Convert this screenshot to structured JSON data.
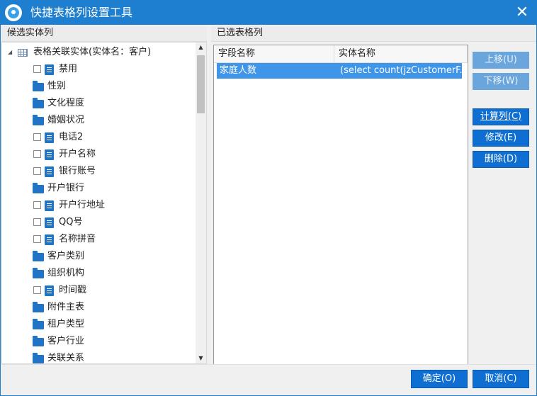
{
  "window": {
    "title": "快捷表格列设置工具",
    "close_icon": "close-icon",
    "accent_color": "#1e7fd0",
    "selection_color": "#3f95e8"
  },
  "left_panel": {
    "header": "候选实体列",
    "tree": {
      "root_label": "表格关联实体(实体名：客户)",
      "items": [
        {
          "label": "禁用",
          "type": "field"
        },
        {
          "label": "性别",
          "type": "folder"
        },
        {
          "label": "文化程度",
          "type": "folder"
        },
        {
          "label": "婚姻状况",
          "type": "folder"
        },
        {
          "label": "电话2",
          "type": "field"
        },
        {
          "label": "开户名称",
          "type": "field"
        },
        {
          "label": "银行账号",
          "type": "field"
        },
        {
          "label": "开户银行",
          "type": "folder"
        },
        {
          "label": "开户行地址",
          "type": "field"
        },
        {
          "label": "QQ号",
          "type": "field"
        },
        {
          "label": "名称拼音",
          "type": "field"
        },
        {
          "label": "客户类别",
          "type": "folder"
        },
        {
          "label": "组织机构",
          "type": "folder"
        },
        {
          "label": "时间戳",
          "type": "field"
        },
        {
          "label": "附件主表",
          "type": "folder"
        },
        {
          "label": "租户类型",
          "type": "folder"
        },
        {
          "label": "客户行业",
          "type": "folder"
        },
        {
          "label": "关联关系",
          "type": "folder"
        }
      ]
    }
  },
  "right_panel": {
    "header": "已选表格列",
    "columns": [
      "字段名称",
      "实体名称"
    ],
    "rows": [
      {
        "field_name": "家庭人数",
        "entity_name": "(select count(jzCustomerF..."
      }
    ]
  },
  "side_buttons": {
    "move_up": "上移(U)",
    "move_down": "下移(W)",
    "compute_col": "计算列(C)",
    "edit": "修改(E)",
    "delete": "删除(D)"
  },
  "footer": {
    "ok": "确定(O)",
    "cancel": "取消(C)"
  }
}
